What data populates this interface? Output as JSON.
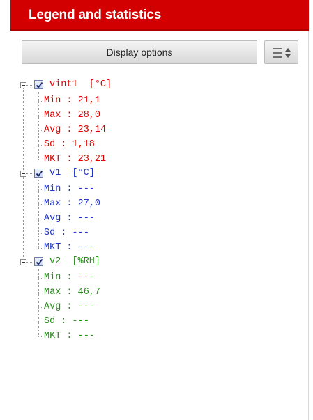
{
  "header": {
    "title": "Legend and statistics"
  },
  "toolbar": {
    "display_options_label": "Display options"
  },
  "colors": {
    "header": "#d20000",
    "v1": "#e00000",
    "v2": "#1f36c8",
    "v3": "#2a8a1e"
  },
  "series": [
    {
      "name": "vint1",
      "unit": "[°C]",
      "color": "#e00000",
      "checked": true,
      "stats": [
        {
          "label": "Min : 21,1"
        },
        {
          "label": "Max : 28,0"
        },
        {
          "label": "Avg : 23,14"
        },
        {
          "label": "Sd : 1,18"
        },
        {
          "label": "MKT : 23,21"
        }
      ]
    },
    {
      "name": "v1",
      "unit": "[°C]",
      "color": "#1f36c8",
      "checked": true,
      "stats": [
        {
          "label": "Min : ---"
        },
        {
          "label": "Max : 27,0"
        },
        {
          "label": "Avg : ---"
        },
        {
          "label": "Sd : ---"
        },
        {
          "label": "MKT : ---"
        }
      ]
    },
    {
      "name": "v2",
      "unit": "[%RH]",
      "color": "#2a8a1e",
      "checked": true,
      "stats": [
        {
          "label": "Min : ---"
        },
        {
          "label": "Max : 46,7"
        },
        {
          "label": "Avg : ---"
        },
        {
          "label": "Sd : ---"
        },
        {
          "label": "MKT : ---"
        }
      ]
    }
  ]
}
